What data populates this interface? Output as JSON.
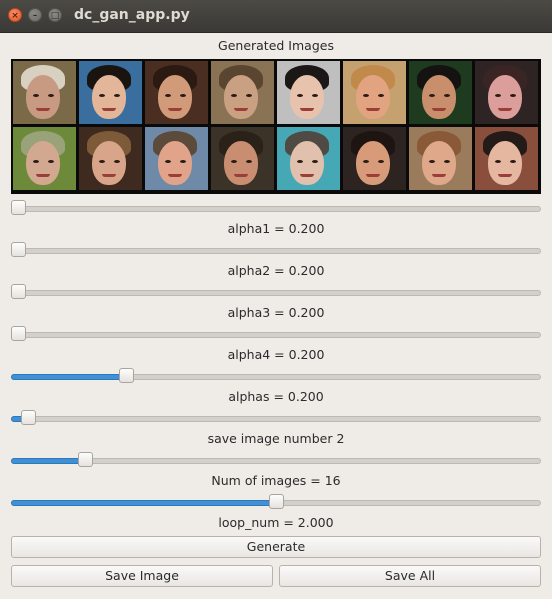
{
  "window": {
    "title": "dc_gan_app.py"
  },
  "images": {
    "title": "Generated Images",
    "tiles": [
      {
        "bg": "#7b6a48",
        "skin": "#c89a82",
        "hair": "#d8d0c0"
      },
      {
        "bg": "#3a6e9e",
        "skin": "#e3b69a",
        "hair": "#1a1411"
      },
      {
        "bg": "#4a2e22",
        "skin": "#d19a78",
        "hair": "#2a1a12"
      },
      {
        "bg": "#8a7354",
        "skin": "#caa082",
        "hair": "#5a4530"
      },
      {
        "bg": "#bfbfbf",
        "skin": "#e7c3ad",
        "hair": "#1b1716"
      },
      {
        "bg": "#c6a170",
        "skin": "#e2a380",
        "hair": "#c18a4a"
      },
      {
        "bg": "#1f3b1f",
        "skin": "#c98f6c",
        "hair": "#151311"
      },
      {
        "bg": "#2e2424",
        "skin": "#dc9e9a",
        "hair": "#3a2424"
      },
      {
        "bg": "#6c8a3a",
        "skin": "#d2a891",
        "hair": "#9aa27a"
      },
      {
        "bg": "#3e2a1e",
        "skin": "#d8a58a",
        "hair": "#7d5b39"
      },
      {
        "bg": "#6f8aa8",
        "skin": "#e1a48b",
        "hair": "#5c4a3a"
      },
      {
        "bg": "#3b3228",
        "skin": "#c98e72",
        "hair": "#2a2118"
      },
      {
        "bg": "#46a7b5",
        "skin": "#e1c0ad",
        "hair": "#4f4a44"
      },
      {
        "bg": "#2d2320",
        "skin": "#d79b7a",
        "hair": "#1e1512"
      },
      {
        "bg": "#9a7b5c",
        "skin": "#e0a88a",
        "hair": "#8a5a38"
      },
      {
        "bg": "#8a4e3c",
        "skin": "#e6b7a0",
        "hair": "#241a18"
      }
    ]
  },
  "controls": [
    {
      "label": "alpha1 = 0.200",
      "fraction": 0.0
    },
    {
      "label": "alpha2 = 0.200",
      "fraction": 0.0
    },
    {
      "label": "alpha3 = 0.200",
      "fraction": 0.0
    },
    {
      "label": "alpha4 = 0.200",
      "fraction": 0.0
    },
    {
      "label": "alphas = 0.200",
      "fraction": 0.21
    },
    {
      "label": "save image number 2",
      "fraction": 0.02
    },
    {
      "label": "Num of images = 16",
      "fraction": 0.13
    },
    {
      "label": "loop_num = 2.000",
      "fraction": 0.5
    }
  ],
  "buttons": {
    "generate": "Generate",
    "save_image": "Save Image",
    "save_all": "Save All"
  },
  "colors": {
    "accent": "#3f90d6"
  }
}
